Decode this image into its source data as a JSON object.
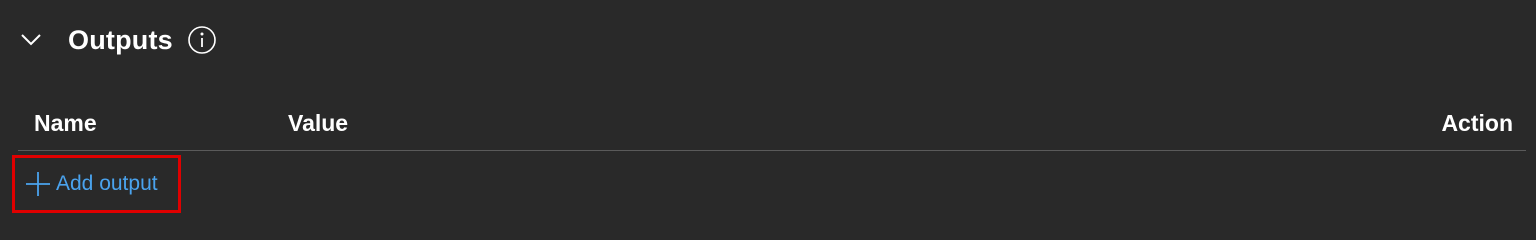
{
  "section": {
    "title": "Outputs",
    "chevron_icon": "chevron-down-icon",
    "info_icon": "info-icon"
  },
  "table": {
    "columns": [
      "Name",
      "Value",
      "Action"
    ],
    "rows": []
  },
  "add_output": {
    "label": "Add output",
    "icon": "plus-icon"
  },
  "colors": {
    "background": "#292929",
    "text": "#ffffff",
    "link": "#4aa3ee",
    "highlight_border": "#e00000",
    "divider": "#5a5a5a"
  }
}
